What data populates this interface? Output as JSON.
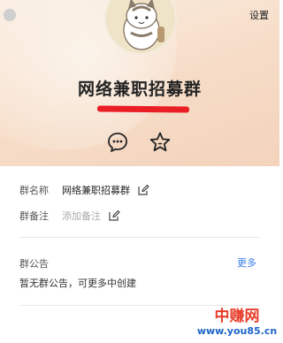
{
  "header": {
    "settings_label": "设置",
    "group_name": "网络兼职招募群"
  },
  "actions": [
    {
      "icon": "chat-bubble-icon"
    },
    {
      "icon": "star-icon"
    }
  ],
  "info": {
    "name_label": "群名称",
    "name_value": "网络兼职招募群",
    "remark_label": "群备注",
    "remark_placeholder": "添加备注",
    "notice_label": "群公告",
    "notice_more": "更多",
    "notice_text": "暂无群公告，可更多中创建"
  },
  "watermark": {
    "brand": "中赚网",
    "url": "www.you85.cn"
  },
  "colors": {
    "header_bg": "#f6dcc7",
    "link": "#3a7de6",
    "redaction": "#ea1f25"
  }
}
